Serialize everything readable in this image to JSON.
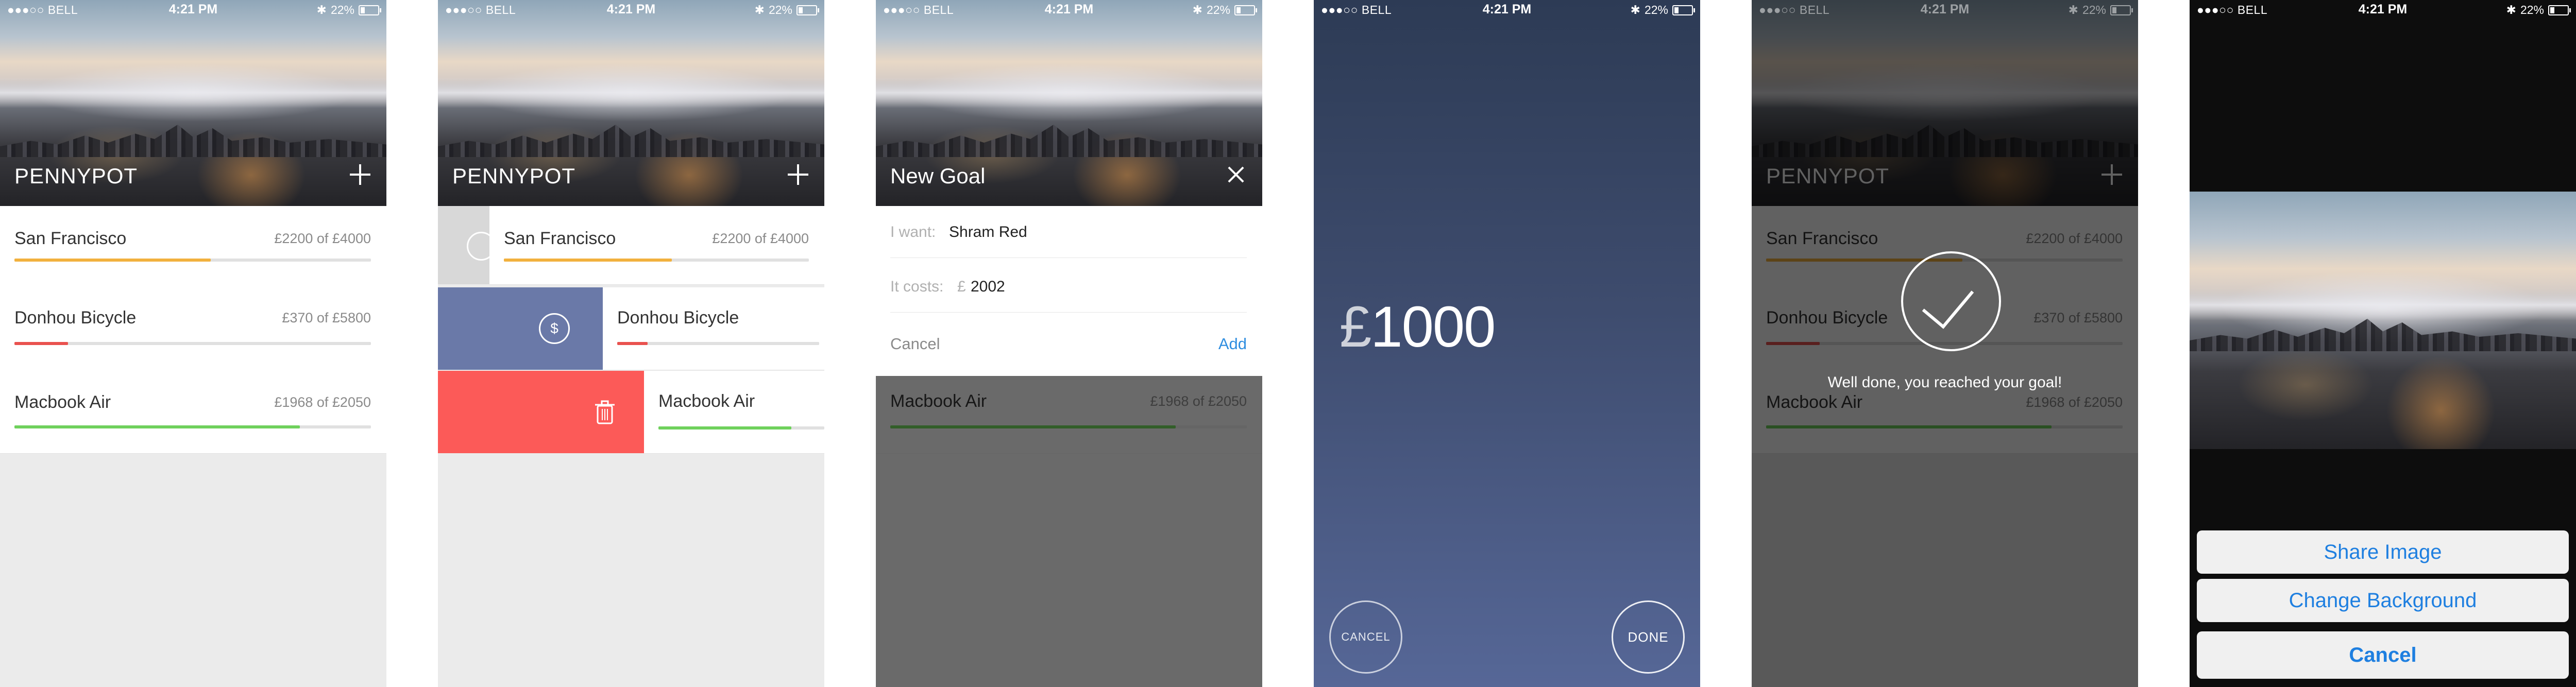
{
  "status": {
    "carrier": "●●●○○ BELL",
    "time": "4:21 PM",
    "battery": "22%"
  },
  "app": {
    "title": "PENNYPOT"
  },
  "goals": [
    {
      "name": "San Francisco",
      "amount": "£2200 of £4000",
      "progress": 0.55,
      "color": "#f2b13e"
    },
    {
      "name": "Donhou Bicycle",
      "amount": "£370 of £5800",
      "progress": 0.15,
      "color": "#e9524f"
    },
    {
      "name": "Macbook Air",
      "amount": "£1968 of £2050",
      "progress": 0.8,
      "color": "#6fd15c"
    }
  ],
  "swipe": {
    "deposit_icon": "$",
    "delete_icon": "trash-icon",
    "deposit_color": "#6a79a8",
    "delete_color": "#fc5a58"
  },
  "new_goal": {
    "title": "New Goal",
    "want_label": "I want:",
    "want_value": "Shram Red",
    "cost_label": "It costs:",
    "cost_currency": "£",
    "cost_value": "2002",
    "cancel": "Cancel",
    "add": "Add"
  },
  "deposit": {
    "currency": "£",
    "amount": "1000",
    "cancel": "CANCEL",
    "done": "DONE"
  },
  "success": {
    "message": "Well done, you reached your goal!"
  },
  "sheet": {
    "share": "Share Image",
    "change": "Change Background",
    "cancel": "Cancel"
  },
  "colors": {
    "accent_blue": "#2f8ee0",
    "gradient_top": "#2d3b55",
    "gradient_bottom": "#566797"
  }
}
